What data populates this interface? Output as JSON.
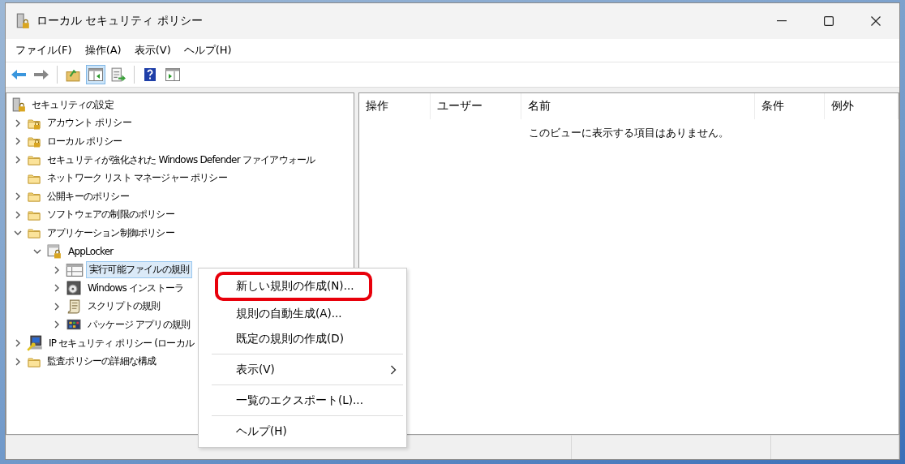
{
  "window": {
    "title": "ローカル セキュリティ ポリシー",
    "controls": [
      {
        "kind": "minimize"
      },
      {
        "kind": "maximize"
      },
      {
        "kind": "close"
      }
    ]
  },
  "menu": [
    "ファイル(F)",
    "操作(A)",
    "表示(V)",
    "ヘルプ(H)"
  ],
  "toolbar": [
    {
      "kind": "back",
      "pressed": false
    },
    {
      "kind": "forward",
      "pressed": false
    },
    {
      "kind": "separator"
    },
    {
      "kind": "up",
      "pressed": false
    },
    {
      "kind": "tree",
      "pressed": true
    },
    {
      "kind": "export",
      "pressed": false
    },
    {
      "kind": "separator"
    },
    {
      "kind": "help",
      "pressed": false
    },
    {
      "kind": "pane",
      "pressed": false
    }
  ],
  "tree": [
    {
      "label": "セキュリティの設定",
      "kind": "server",
      "selected": false,
      "children": [
        {
          "label": "アカウント ポリシー",
          "kind": "locked-folder",
          "expanded": false,
          "selected": false
        },
        {
          "label": "ローカル ポリシー",
          "kind": "locked-folder",
          "expanded": false,
          "selected": false
        },
        {
          "label": "セキュリティが強化された Windows Defender ファイアウォール",
          "kind": "folder",
          "expanded": false,
          "selected": false
        },
        {
          "label": "ネットワーク リスト マネージャー ポリシー",
          "kind": "folder",
          "selected": false
        },
        {
          "label": "公開キーのポリシー",
          "kind": "folder",
          "expanded": false,
          "selected": false
        },
        {
          "label": "ソフトウェアの制限のポリシー",
          "kind": "folder",
          "expanded": false,
          "selected": false
        },
        {
          "label": "アプリケーション制御ポリシー",
          "kind": "folder",
          "expanded": true,
          "selected": false,
          "children": [
            {
              "label": "AppLocker",
              "kind": "applocker",
              "expanded": true,
              "selected": false,
              "children": [
                {
                  "label": "実行可能ファイルの規則",
                  "kind": "table",
                  "expanded": false,
                  "selected": true
                },
                {
                  "label": "Windows インストーラ",
                  "kind": "installer",
                  "expanded": false,
                  "selected": false
                },
                {
                  "label": "スクリプトの規則",
                  "kind": "script",
                  "expanded": false,
                  "selected": false
                },
                {
                  "label": "パッケージ アプリの規則",
                  "kind": "package",
                  "expanded": false,
                  "selected": false
                }
              ]
            }
          ]
        },
        {
          "label": "IP セキュリティ ポリシー (ローカル",
          "kind": "ip",
          "expanded": false,
          "selected": false
        },
        {
          "label": "監査ポリシーの詳細な構成",
          "kind": "folder",
          "expanded": false,
          "selected": false
        }
      ]
    }
  ],
  "table": {
    "columns": [
      "操作",
      "ユーザー",
      "名前",
      "条件",
      "例外"
    ],
    "empty_message": "このビューに表示する項目はありません。"
  },
  "context_menu": [
    {
      "kind": "item",
      "label": "新しい規則の作成(N)...",
      "submenu": false,
      "highlighted": true
    },
    {
      "kind": "item",
      "label": "規則の自動生成(A)...",
      "submenu": false,
      "highlighted": false
    },
    {
      "kind": "item",
      "label": "既定の規則の作成(D)",
      "submenu": false,
      "highlighted": false
    },
    {
      "kind": "separator"
    },
    {
      "kind": "item",
      "label": "表示(V)",
      "submenu": true,
      "highlighted": false
    },
    {
      "kind": "separator"
    },
    {
      "kind": "item",
      "label": "一覧のエクスポート(L)...",
      "submenu": false,
      "highlighted": false
    },
    {
      "kind": "separator"
    },
    {
      "kind": "item",
      "label": "ヘルプ(H)",
      "submenu": false,
      "highlighted": false
    }
  ]
}
